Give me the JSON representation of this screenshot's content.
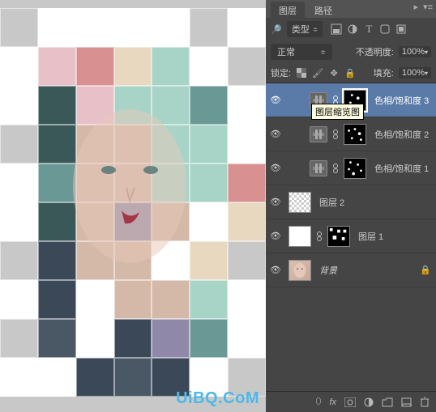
{
  "tabs": {
    "layers": "图层",
    "paths": "路径"
  },
  "filter": {
    "kind_label": "类型",
    "icons": [
      "image-filter-icon",
      "adjustment-filter-icon",
      "type-filter-icon",
      "shape-filter-icon",
      "smart-filter-icon"
    ]
  },
  "blend": {
    "mode": "正常",
    "opacity_label": "不透明度:",
    "opacity_value": "100%"
  },
  "lock": {
    "label": "锁定:",
    "icons": [
      "lock-transparency-icon",
      "lock-image-icon",
      "lock-position-icon",
      "lock-all-icon"
    ],
    "fill_label": "填充:",
    "fill_value": "100%"
  },
  "layers": [
    {
      "type": "adjustment",
      "name": "色相/饱和度 3",
      "selected": true,
      "indent": true
    },
    {
      "type": "adjustment",
      "name": "色相/饱和度 2",
      "selected": false,
      "indent": true
    },
    {
      "type": "adjustment",
      "name": "色相/饱和度 1",
      "selected": false,
      "indent": true
    },
    {
      "type": "pixel",
      "name": "图层 2",
      "thumb": "checker",
      "selected": false
    },
    {
      "type": "masked",
      "name": "图层 1",
      "selected": false
    },
    {
      "type": "bg",
      "name": "背景",
      "selected": false
    }
  ],
  "tooltip": "图层缩览图",
  "watermark": "UiBQ.CoM",
  "bottom_icons": [
    "link-icon",
    "fx-icon",
    "mask-icon",
    "adjustment-icon",
    "group-icon",
    "new-icon",
    "trash-icon"
  ],
  "colors": {
    "panel_bg": "#535353",
    "panel_inner": "#454545",
    "selected": "#5a7aa8",
    "tooltip_bg": "#ffffe1",
    "watermark": "#4db8e8"
  }
}
